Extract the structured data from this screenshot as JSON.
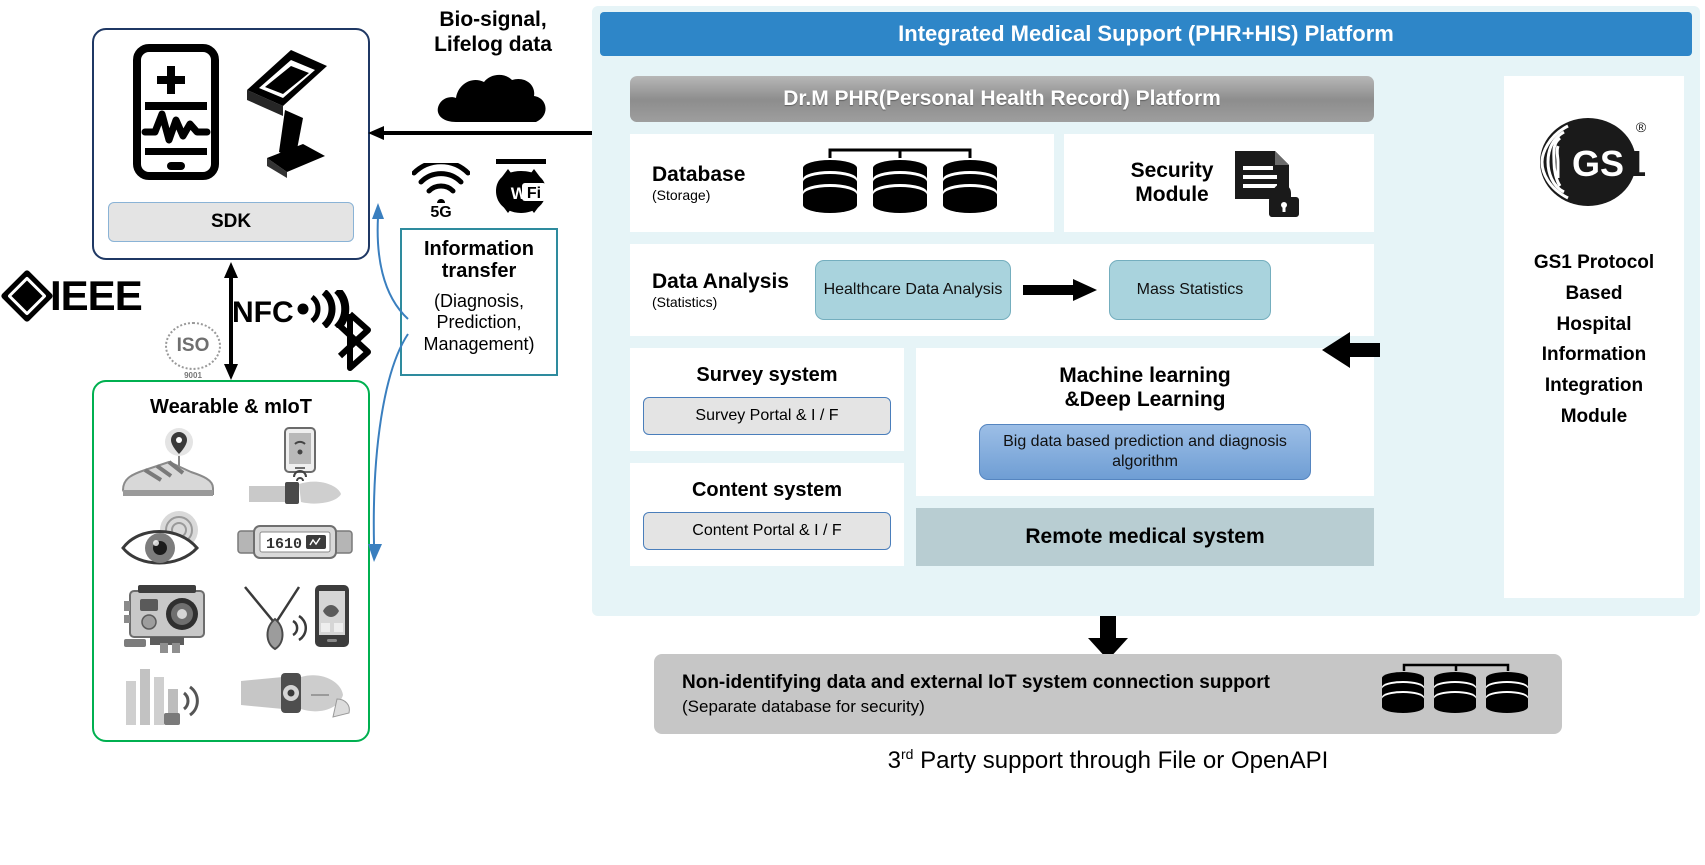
{
  "left": {
    "device_panel": {
      "name": "device-panel",
      "sdk_label": "SDK",
      "icons": [
        "smartphone-ecg-icon",
        "kiosk-terminal-icon"
      ]
    },
    "ieee": {
      "label": "IEEE"
    },
    "iso": {
      "label": "ISO",
      "sub": "9001"
    },
    "nfc": {
      "label": "NFC"
    },
    "bluetooth": {
      "label": "bluetooth-icon"
    },
    "wearable_panel": {
      "title": "Wearable & mIoT",
      "items": [
        "smart-shoe-gps-icon",
        "smart-watch-phone-icon",
        "smart-contact-lens-eye-icon",
        "fitness-band-1610-icon",
        "action-camera-icon",
        "smart-pendant-phone-icon",
        "signal-sensor-icon",
        "wrist-sensor-icon"
      ]
    }
  },
  "mid": {
    "bio_label": "Bio-signal,\nLifelog data",
    "cloud": "cloud-icon",
    "networks": [
      {
        "icon": "5g-signal-icon",
        "label": "5G"
      },
      {
        "icon": "wifi-badge-icon",
        "label": "Wi Fi"
      }
    ],
    "info_transfer": {
      "title": "Information transfer",
      "subtitle": "(Diagnosis,\nPrediction,\nManagement)"
    }
  },
  "platform": {
    "title": "Integrated Medical Support (PHR+HIS) Platform",
    "phr_title": "Dr.M PHR(Personal Health Record) Platform",
    "database": {
      "main": "Database",
      "sub": "(Storage)",
      "icon": "database-cluster-icon"
    },
    "security": {
      "main": "Security Module",
      "icon": "document-lock-icon"
    },
    "analysis": {
      "main": "Data Analysis",
      "sub": "(Statistics)",
      "box1": "Healthcare Data Analysis",
      "arrow": "right-arrow-icon",
      "box2": "Mass Statistics"
    },
    "survey": {
      "title": "Survey system",
      "portal": "Survey Portal & I / F"
    },
    "content": {
      "title": "Content system",
      "portal": "Content Portal & I / F"
    },
    "ml": {
      "title": "Machine learning\n&Deep Learning",
      "box": "Big data based prediction and diagnosis algorithm"
    },
    "remote": {
      "title": "Remote medical system"
    },
    "gs1": {
      "logo": "gs1-logo-icon",
      "lines": [
        "GS1 Protocol",
        "Based",
        "Hospital",
        "Information",
        "Integration",
        "Module"
      ]
    }
  },
  "bottom": {
    "arrow": "down-arrow-icon",
    "line1": "Non-identifying  data and external IoT system  connection  support",
    "line2": "(Separate database  for security)",
    "dbs": "database-cluster-icon",
    "caption_pre": "3",
    "caption_sup": "rd",
    "caption_post": " Party support through File or OpenAPI"
  },
  "colors": {
    "header_blue": "#2e86c8",
    "platform_bg": "#e6f4f7",
    "teal_box": "#a9d3dd",
    "blue_box": "#6f9ed4",
    "remote_bg": "#b8cdd2",
    "green_border": "#00b050",
    "navy_border": "#1f3864",
    "bottom_bar": "#c6c6c6"
  }
}
